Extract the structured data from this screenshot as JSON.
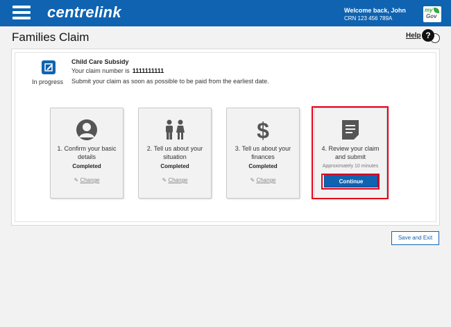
{
  "header": {
    "brand": "centrelink",
    "welcome": "Welcome back, John",
    "crn": "CRN 123 456 789A",
    "mygov_my": "my",
    "mygov_gov": "Gov",
    "color": "#0f63b1"
  },
  "page": {
    "title": "Families Claim",
    "help_label": "Help",
    "help_icon_glyph": "?"
  },
  "claim": {
    "status": "In progress",
    "title": "Child Care Subsidy",
    "number_label": "Your claim number is",
    "number": "1111111111",
    "note": "Submit your claim as soon as possible to be paid from the earliest date."
  },
  "steps": [
    {
      "title": "1. Confirm your basic details",
      "status": "Completed",
      "change": "Change",
      "icon": "person-icon"
    },
    {
      "title": "2. Tell us about your situation",
      "status": "Completed",
      "change": "Change",
      "icon": "family-icon"
    },
    {
      "title": "3. Tell us about your finances",
      "status": "Completed",
      "change": "Change",
      "icon": "dollar-icon"
    },
    {
      "title": "4. Review your claim and submit",
      "duration": "Approximately 10 minutes",
      "button": "Continue",
      "icon": "document-icon"
    }
  ],
  "actions": {
    "save_exit": "Save and Exit"
  },
  "colors": {
    "primary": "#0f63b1",
    "highlight": "#e3001b",
    "icon_grey": "#555555"
  }
}
